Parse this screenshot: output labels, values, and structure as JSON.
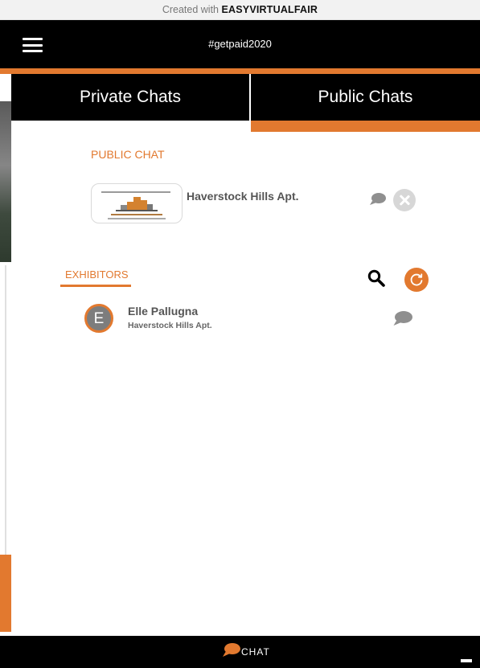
{
  "credit": {
    "prefix": "Created with ",
    "brand": "EASYVIRTUALFAIR"
  },
  "header": {
    "title": "#getpaid2020"
  },
  "tabs": [
    {
      "label": "Private Chats",
      "active": false
    },
    {
      "label": "Public Chats",
      "active": true
    }
  ],
  "public_chat": {
    "section_label": "PUBLIC CHAT",
    "name": "Haverstock Hills Apt."
  },
  "exhibitors": {
    "section_label": "EXHIBITORS",
    "items": [
      {
        "initial": "E",
        "name": "Elle Pallugna",
        "company": "Haverstock Hills Apt."
      }
    ]
  },
  "footer": {
    "chat_label": "CHAT"
  },
  "colors": {
    "accent": "#e2792f",
    "header_bg": "#000000",
    "bubble_gray": "#999999"
  },
  "icons": [
    "hamburger-icon",
    "chat-bubble-icon",
    "close-icon",
    "search-icon",
    "refresh-icon",
    "minimize-icon"
  ]
}
